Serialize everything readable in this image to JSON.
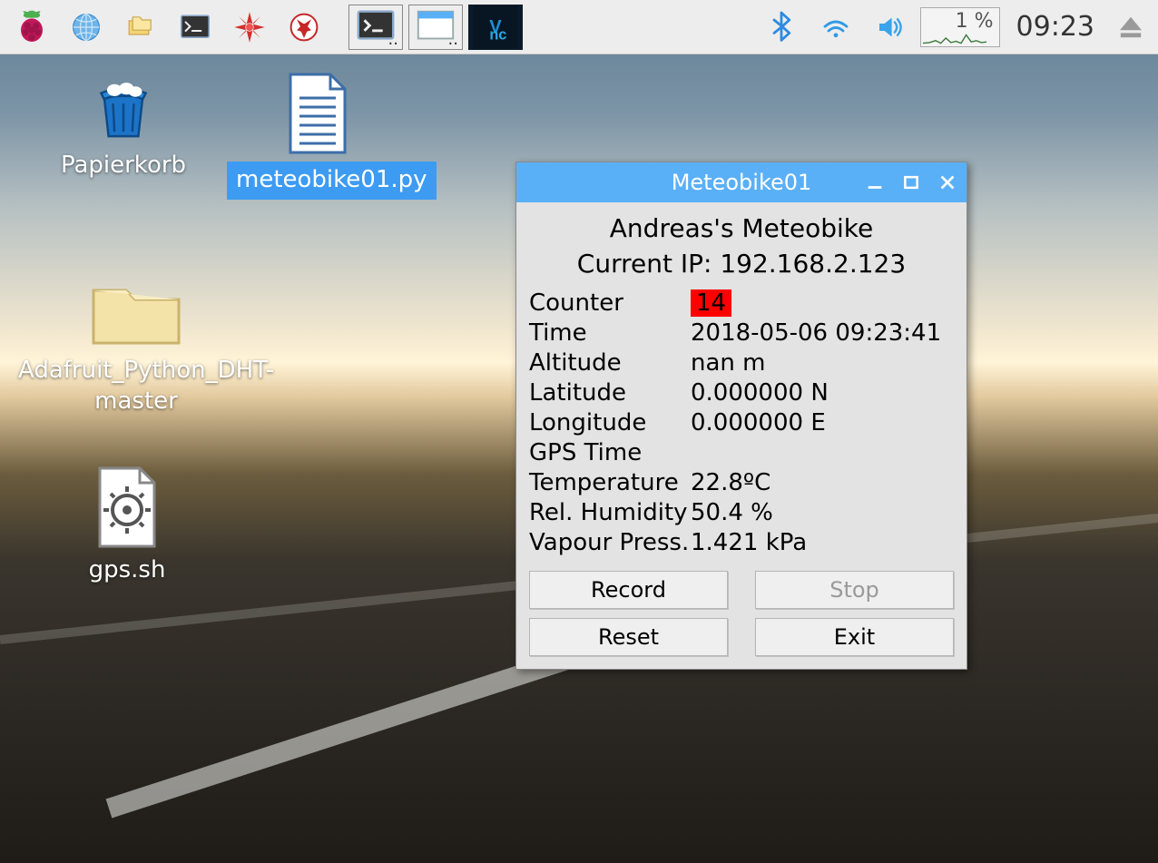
{
  "taskbar": {
    "cpu_percent": "1 %",
    "clock": "09:23",
    "task_terminal_dots": "..",
    "task_window_dots": ".."
  },
  "desktop_icons": {
    "trash": "Papierkorb",
    "meteobike_py": "meteobike01.py",
    "adafruit": "Adafruit_Python_DHT-master",
    "gps_sh": "gps.sh"
  },
  "window": {
    "title": "Meteobike01",
    "heading": "Andreas's Meteobike",
    "ip_line": "Current IP: 192.168.2.123",
    "rows": {
      "counter_label": "Counter",
      "counter_value": "14",
      "time_label": "Time",
      "time_value": "2018-05-06 09:23:41",
      "altitude_label": "Altitude",
      "altitude_value": "nan m",
      "latitude_label": "Latitude",
      "latitude_value": "0.000000 N",
      "longitude_label": "Longitude",
      "longitude_value": "0.000000 E",
      "gpstime_label": "GPS Time",
      "gpstime_value": "",
      "temperature_label": "Temperature",
      "temperature_value": "22.8ºC",
      "humidity_label": "Rel. Humidity",
      "humidity_value": "50.4 %",
      "vapour_label": "Vapour Press.",
      "vapour_value": "1.421 kPa"
    },
    "buttons": {
      "record": "Record",
      "stop": "Stop",
      "reset": "Reset",
      "exit": "Exit"
    }
  }
}
